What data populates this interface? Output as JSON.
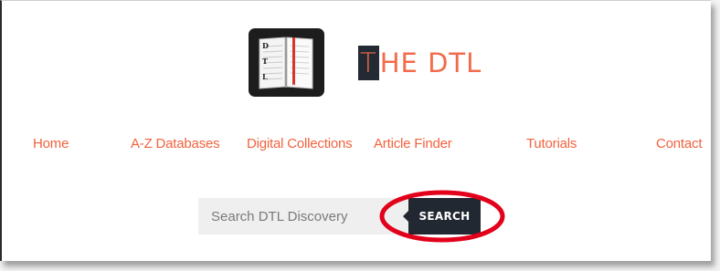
{
  "brand": {
    "title_first_letter": "T",
    "title_rest": "HE DTL",
    "logo_letters": [
      "D",
      "T",
      "L"
    ],
    "accent_color": "#f26b4b",
    "dark_color": "#212831"
  },
  "nav": {
    "items": [
      {
        "label": "Home"
      },
      {
        "label": "A-Z Databases"
      },
      {
        "label": "Digital Collections"
      },
      {
        "label": "Article Finder"
      },
      {
        "label": "Tutorials"
      },
      {
        "label": "Contact"
      }
    ]
  },
  "search": {
    "placeholder": "Search DTL Discovery",
    "value": "",
    "button_label": "SEARCH"
  },
  "annotation": {
    "highlight_color": "#e2001a",
    "highlight_target": "search-button"
  }
}
